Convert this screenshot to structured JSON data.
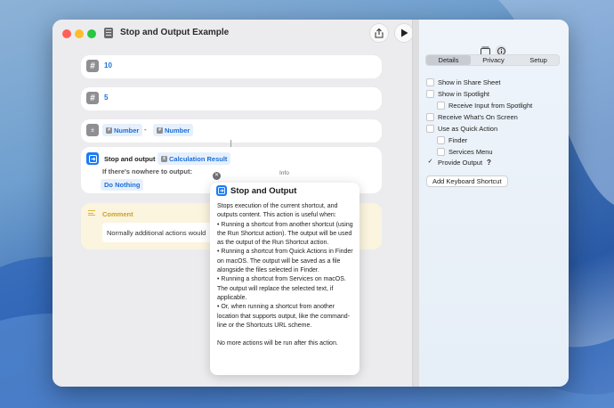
{
  "window": {
    "title": "Stop and Output Example"
  },
  "toolbar": {
    "share_icon": "share-icon",
    "run_icon": "play-icon",
    "library_icon": "library-icon",
    "info_icon": "info-icon"
  },
  "actions": {
    "number1": {
      "value": "10"
    },
    "number2": {
      "value": "5"
    },
    "calculate": {
      "left": "Number",
      "operator": "-",
      "right": "Number"
    },
    "stop_output": {
      "label": "Stop and output",
      "variable": "Calculation Result",
      "fallback_label": "If there's nowhere to output:",
      "fallback_value": "Do Nothing"
    },
    "comment": {
      "title": "Comment",
      "body": "Normally additional actions would"
    }
  },
  "info_popover": {
    "label": "Info",
    "title": "Stop and Output",
    "description": "Stops execution of the current shortcut, and outputs content. This action is useful when:\n• Running a shortcut from another shortcut (using the Run Shortcut action). The output will be used as the output of the Run Shortcut action.\n• Running a shortcut from Quick Actions in Finder on macOS. The output will be saved as a file alongside the files selected in Finder.\n• Running a shortcut from Services on macOS. The output will replace the selected text, if applicable.\n• Or, when running a shortcut from another location that supports output, like the command-line or the Shortcuts URL scheme.\n\nNo more actions will be run after this action."
  },
  "sidebar": {
    "tabs": [
      "Details",
      "Privacy",
      "Setup"
    ],
    "selected_tab": "Details",
    "options": [
      {
        "label": "Show in Share Sheet",
        "checked": false
      },
      {
        "label": "Show in Spotlight",
        "checked": false
      },
      {
        "label": "Receive Input from Spotlight",
        "checked": false
      },
      {
        "label": "Receive What's On Screen",
        "checked": false
      },
      {
        "label": "Use as Quick Action",
        "checked": false
      },
      {
        "label": "Finder",
        "checked": false
      },
      {
        "label": "Services Menu",
        "checked": false
      },
      {
        "label": "Provide Output",
        "checked": true
      }
    ],
    "help": "?",
    "keyboard_button": "Add Keyboard Shortcut"
  },
  "colors": {
    "accent": "#1c6ed8",
    "stop_icon": "#1a7cf5",
    "comment_bg": "#fbf4de",
    "comment_title": "#c9a12a"
  }
}
